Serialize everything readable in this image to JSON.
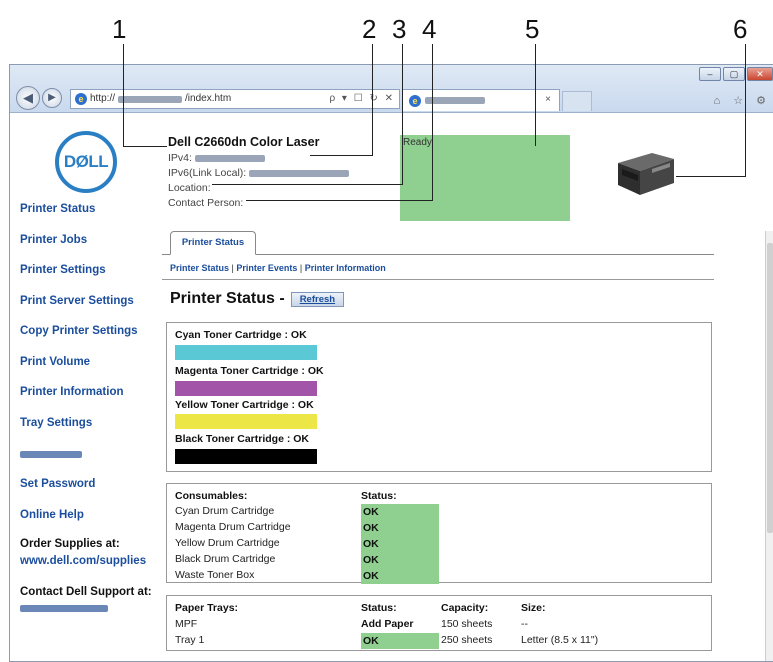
{
  "callouts": [
    "1",
    "2",
    "3",
    "4",
    "5",
    "6"
  ],
  "browser": {
    "address_text": "http://",
    "address_suffix": "/index.htm",
    "address_tools": "ρ ▾ ☐ ↻ ✕",
    "tab_close": "×",
    "toolbar_icons": "⌂ ☆ ⚙",
    "win_buttons": [
      "‒",
      "▢",
      "✕"
    ]
  },
  "logo_text": "DØLL",
  "printer": {
    "model": "Dell C2660dn Color Laser",
    "ipv4_label": "IPv4:",
    "ipv6_label": "IPv6(Link Local):",
    "location_label": "Location:",
    "contact_label": "Contact Person:",
    "status": "Ready"
  },
  "sidebar": {
    "items": [
      "Printer Status",
      "Printer Jobs",
      "Printer Settings",
      "Print Server Settings",
      "Copy Printer Settings",
      "Print Volume",
      "Printer Information",
      "Tray Settings"
    ],
    "set_password": "Set Password",
    "online_help": "Online Help",
    "order_supplies_label": "Order Supplies at:",
    "order_supplies_link": "www.dell.com/supplies",
    "contact_support_label": "Contact Dell Support at:"
  },
  "main": {
    "tab_label": "Printer Status",
    "sublinks": [
      "Printer Status",
      "Printer Events",
      "Printer Information"
    ],
    "sublink_sep": " | ",
    "heading": "Printer Status -",
    "refresh_label": "Refresh"
  },
  "toners": [
    {
      "label": "Cyan Toner Cartridge : OK",
      "color": "#5bc8d6",
      "level": 1.0
    },
    {
      "label": "Magenta Toner Cartridge : OK",
      "color": "#a254a8",
      "level": 1.0
    },
    {
      "label": "Yellow Toner Cartridge : OK",
      "color": "#ede647",
      "level": 1.0
    },
    {
      "label": "Black Toner Cartridge : OK",
      "color": "#000000",
      "level": 1.0
    }
  ],
  "consumables": {
    "header": "Consumables:",
    "status_header": "Status:",
    "rows": [
      {
        "name": "Cyan Drum Cartridge",
        "status": "OK"
      },
      {
        "name": "Magenta Drum Cartridge",
        "status": "OK"
      },
      {
        "name": "Yellow Drum Cartridge",
        "status": "OK"
      },
      {
        "name": "Black Drum Cartridge",
        "status": "OK"
      },
      {
        "name": "Waste Toner Box",
        "status": "OK"
      }
    ]
  },
  "trays": {
    "headers": [
      "Paper Trays:",
      "Status:",
      "Capacity:",
      "Size:"
    ],
    "rows": [
      {
        "name": "MPF",
        "status": "Add Paper",
        "capacity": "150 sheets",
        "size": "--"
      },
      {
        "name": "Tray 1",
        "status": "OK",
        "capacity": "250 sheets",
        "size": "Letter (8.5 x 11\")"
      }
    ]
  }
}
